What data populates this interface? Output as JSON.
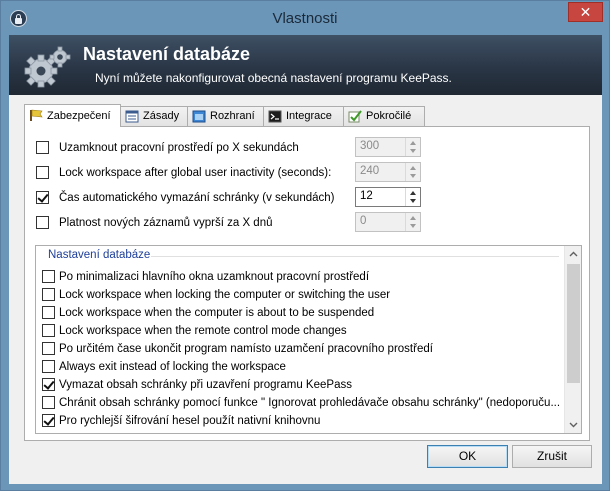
{
  "window": {
    "title": "Vlastnosti",
    "close_glyph": "✕"
  },
  "banner": {
    "title": "Nastavení databáze",
    "subtitle": "Nyní můžete nakonfigurovat obecná nastavení programu KeePass.",
    "icon": "gears-icon"
  },
  "tabs": [
    {
      "label": "Zabezpečení",
      "icon": "security-icon",
      "active": true
    },
    {
      "label": "Zásady",
      "icon": "policy-icon",
      "active": false
    },
    {
      "label": "Rozhraní",
      "icon": "interface-icon",
      "active": false
    },
    {
      "label": "Integrace",
      "icon": "integration-icon",
      "active": false
    },
    {
      "label": "Pokročilé",
      "icon": "advanced-icon",
      "active": false
    }
  ],
  "settings": [
    {
      "label": "Uzamknout pracovní prostředí po X sekundách",
      "checked": false,
      "value": "300",
      "enabled": false
    },
    {
      "label": "Lock workspace after global user inactivity (seconds):",
      "checked": false,
      "value": "240",
      "enabled": false
    },
    {
      "label": "Čas automatického vymazání schránky (v sekundách)",
      "checked": true,
      "value": "12",
      "enabled": true
    },
    {
      "label": "Platnost nových záznamů vyprší za X dnů",
      "checked": false,
      "value": "0",
      "enabled": false
    }
  ],
  "options_list": {
    "group_title": "Nastavení databáze",
    "items": [
      {
        "label": "Po minimalizaci hlavního okna uzamknout pracovní prostředí",
        "checked": false
      },
      {
        "label": "Lock workspace when locking the computer or switching the user",
        "checked": false
      },
      {
        "label": "Lock workspace when the computer is about to be suspended",
        "checked": false
      },
      {
        "label": "Lock workspace when the remote control mode changes",
        "checked": false
      },
      {
        "label": "Po určitém čase ukončit program namísto uzamčení pracovního prostředí",
        "checked": false
      },
      {
        "label": "Always exit instead of locking the workspace",
        "checked": false
      },
      {
        "label": "Vymazat obsah schránky při uzavření programu KeePass",
        "checked": true
      },
      {
        "label": "Chránit obsah schránky pomocí funkce \" Ignorovat prohledávače obsahu schránky\" (nedoporuču...",
        "checked": false
      },
      {
        "label": "Pro rychlejší šifrování hesel použít nativní knihovnu",
        "checked": true
      }
    ]
  },
  "buttons": {
    "ok": "OK",
    "cancel": "Zrušit"
  },
  "colors": {
    "titlebar": "#6b96b8",
    "close": "#c7463f",
    "group_header": "#1e3f9a",
    "banner": "#2a3646"
  }
}
